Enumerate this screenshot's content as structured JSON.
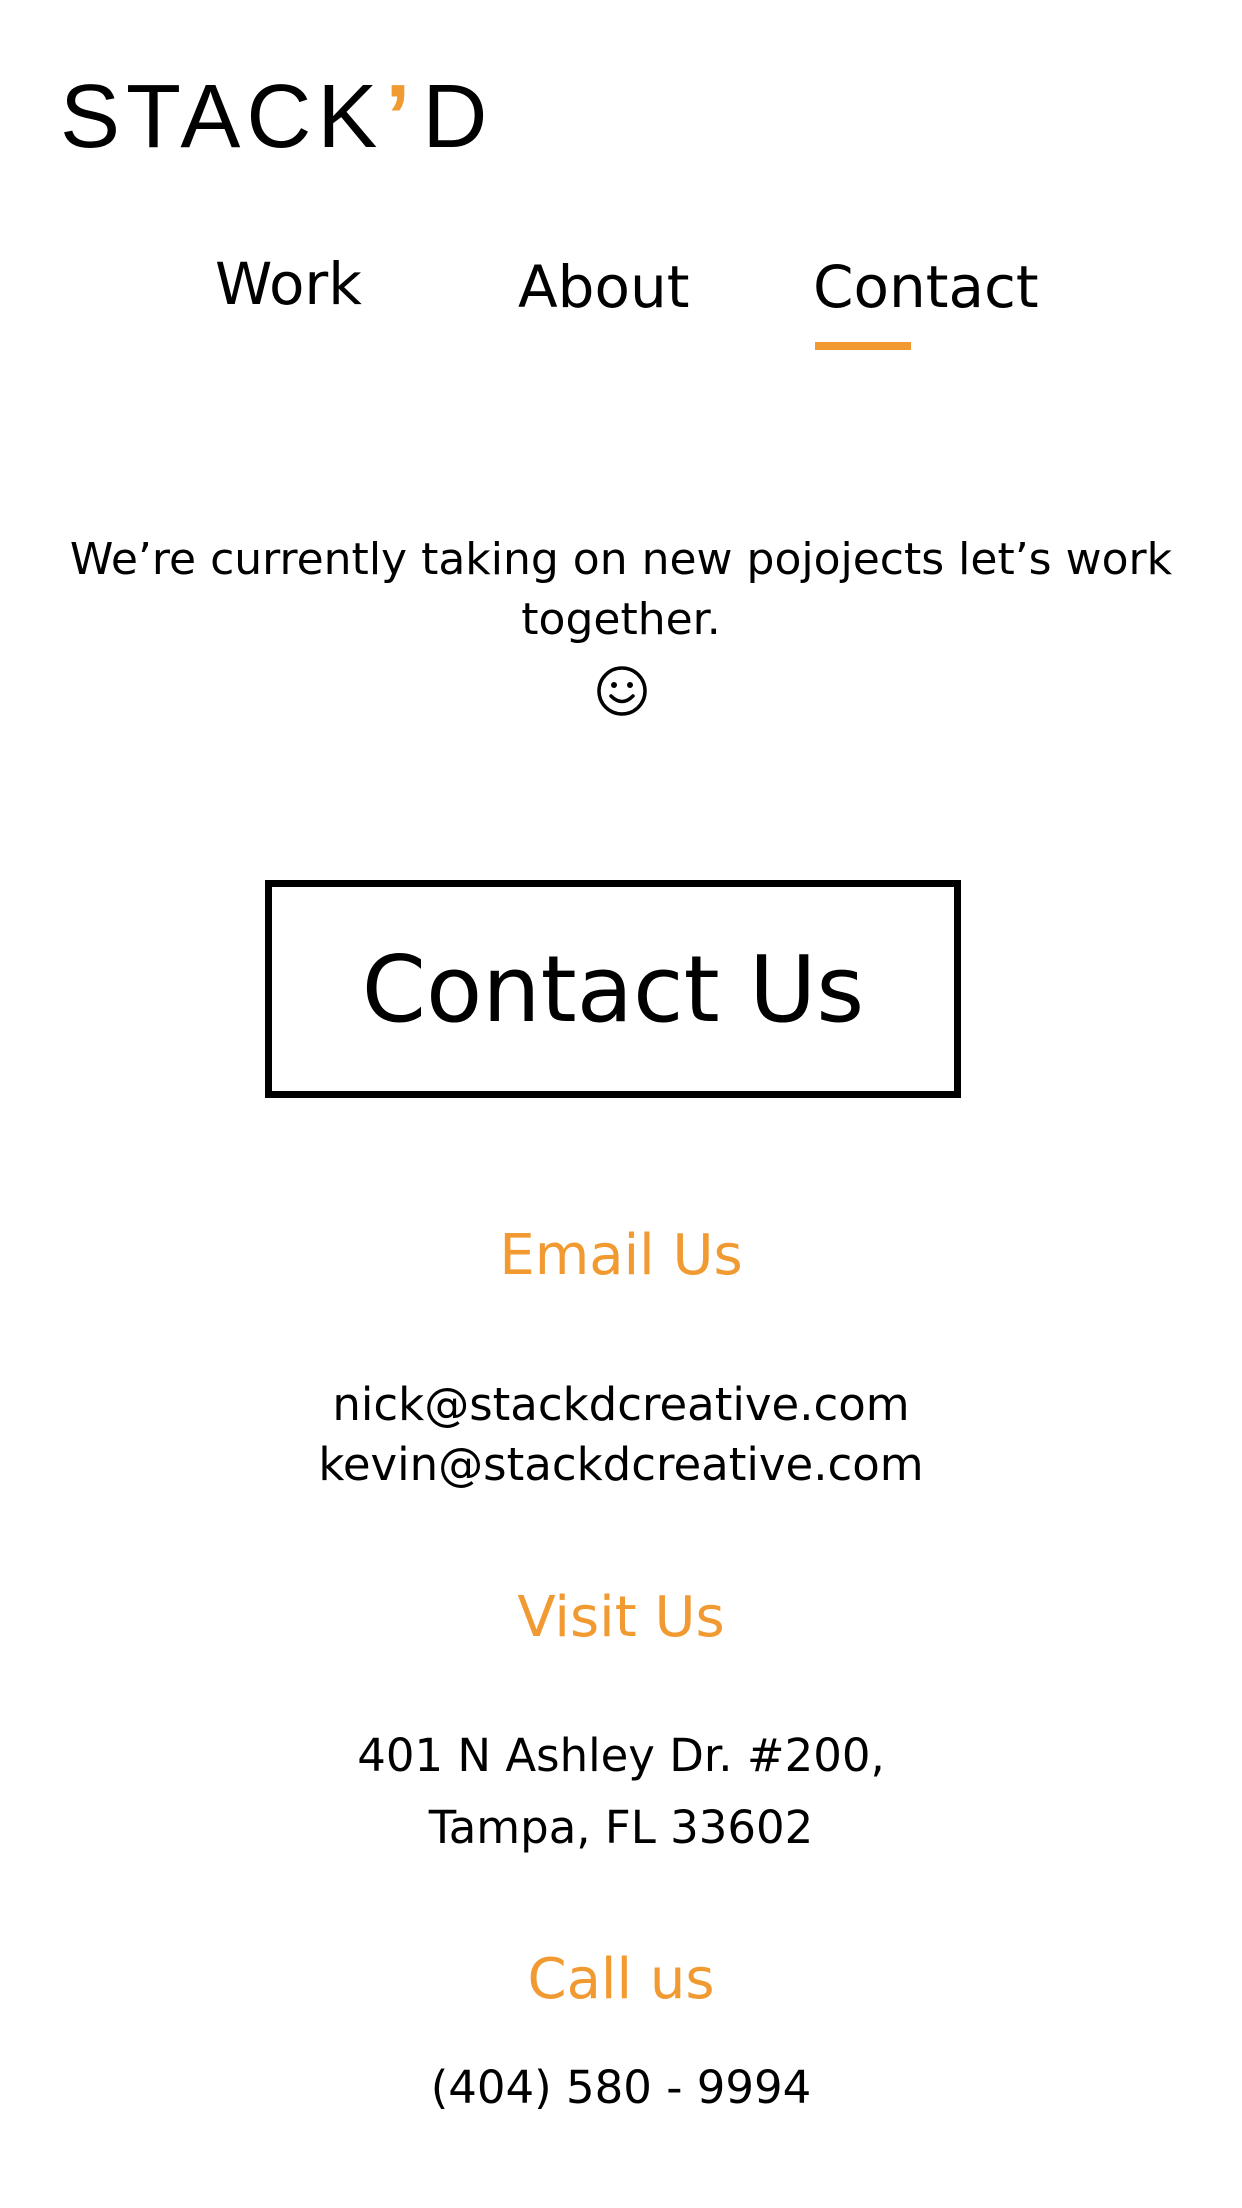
{
  "brand": {
    "logo_left": "STACK",
    "logo_apostrophe": "’",
    "logo_right": "D",
    "accent_color": "#f19a32"
  },
  "nav": {
    "items": [
      {
        "label": "Work"
      },
      {
        "label": "About"
      },
      {
        "label": "Contact"
      }
    ],
    "active": "Contact"
  },
  "intro": {
    "text": "We’re currently taking on new pojojects let’s work together.",
    "icon": "smiley-icon"
  },
  "cta": {
    "label": "Contact Us"
  },
  "email": {
    "heading": "Email Us",
    "addresses": [
      "nick@stackdcreative.com",
      "kevin@stackdcreative.com"
    ]
  },
  "visit": {
    "heading": "Visit Us",
    "line1": "401 N Ashley Dr. #200,",
    "line2": "Tampa, FL 33602"
  },
  "call": {
    "heading": "Call us",
    "phone": "(404) 580 - 9994"
  }
}
